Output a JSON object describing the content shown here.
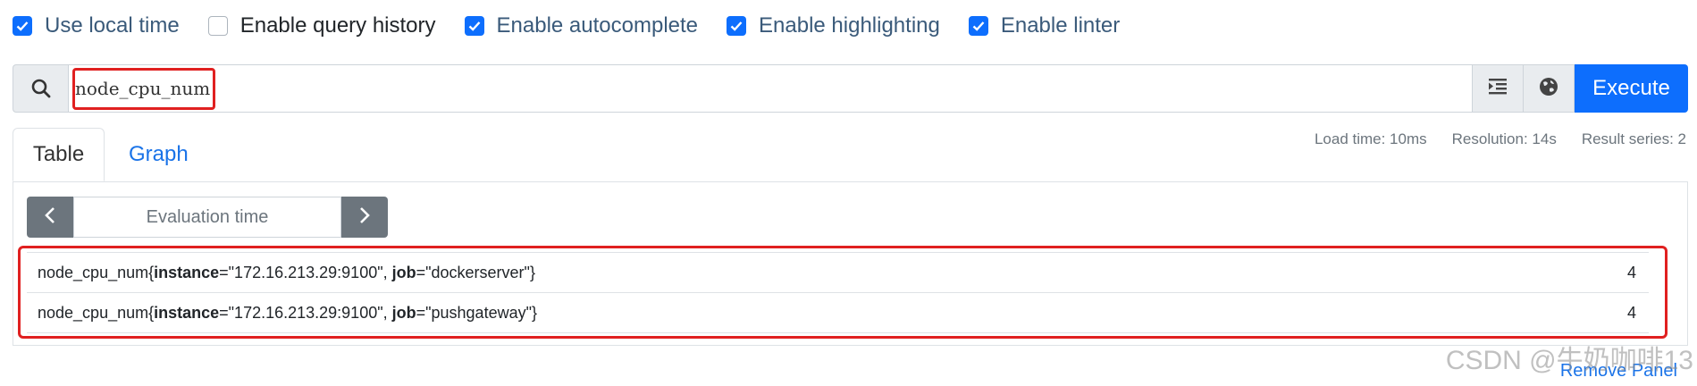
{
  "options": [
    {
      "label": "Use local time",
      "checked": true
    },
    {
      "label": "Enable query history",
      "checked": false
    },
    {
      "label": "Enable autocomplete",
      "checked": true
    },
    {
      "label": "Enable highlighting",
      "checked": true
    },
    {
      "label": "Enable linter",
      "checked": true
    }
  ],
  "query": {
    "value": "node_cpu_num",
    "execute_label": "Execute"
  },
  "tabs": {
    "table": "Table",
    "graph": "Graph"
  },
  "stats": {
    "load_time": "Load time: 10ms",
    "resolution": "Resolution: 14s",
    "result_series": "Result series: 2"
  },
  "eval": {
    "placeholder": "Evaluation time"
  },
  "results": [
    {
      "metric": "node_cpu_num",
      "open": "{",
      "k1": "instance",
      "v1": "=\"172.16.213.29:9100\", ",
      "k2": "job",
      "v2": "=\"dockerserver\"",
      "close": "}",
      "value": "4"
    },
    {
      "metric": "node_cpu_num",
      "open": "{",
      "k1": "instance",
      "v1": "=\"172.16.213.29:9100\", ",
      "k2": "job",
      "v2": "=\"pushgateway\"",
      "close": "}",
      "value": "4"
    }
  ],
  "remove_panel": "Remove Panel",
  "watermark": "CSDN @牛奶咖啡13",
  "colors": {
    "accent": "#0d6efd",
    "highlight": "#e02020"
  }
}
